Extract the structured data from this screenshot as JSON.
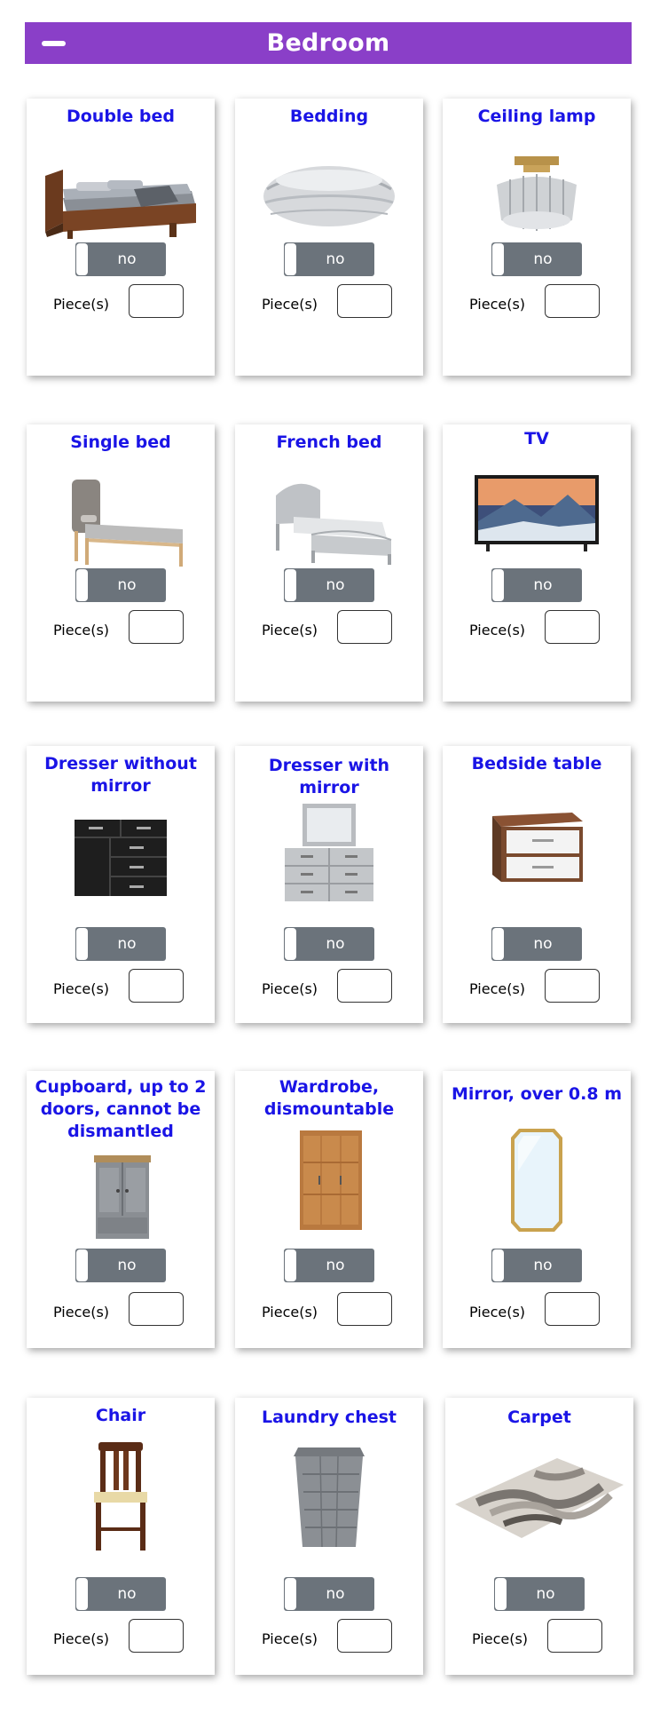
{
  "header": {
    "title": "Bedroom"
  },
  "toggle_label": "no",
  "pieces_label": "Piece(s)",
  "colors": {
    "header": "#8a3fc8",
    "title": "#1a14e6",
    "toggle": "#6b737b"
  },
  "items": [
    {
      "title": "Double bed",
      "icon": "double-bed-image",
      "quantity": ""
    },
    {
      "title": "Bedding",
      "icon": "bedding-image",
      "quantity": ""
    },
    {
      "title": "Ceiling lamp",
      "icon": "ceiling-lamp-image",
      "quantity": ""
    },
    {
      "title": "Single bed",
      "icon": "single-bed-image",
      "quantity": ""
    },
    {
      "title": "French bed",
      "icon": "french-bed-image",
      "quantity": ""
    },
    {
      "title": "TV",
      "icon": "tv-image",
      "quantity": ""
    },
    {
      "title": "Dresser without mirror",
      "icon": "dresser-image",
      "quantity": ""
    },
    {
      "title": "Dresser with mirror",
      "icon": "dresser-mirror-image",
      "quantity": ""
    },
    {
      "title": "Bedside table",
      "icon": "bedside-table-image",
      "quantity": ""
    },
    {
      "title": "Cupboard, up to 2 doors, cannot be dismantled",
      "icon": "cupboard-image",
      "quantity": ""
    },
    {
      "title": "Wardrobe, dismountable",
      "icon": "wardrobe-image",
      "quantity": ""
    },
    {
      "title": "Mirror, over 0.8 m",
      "icon": "mirror-image",
      "quantity": ""
    },
    {
      "title": "Chair",
      "icon": "chair-image",
      "quantity": ""
    },
    {
      "title": "Laundry chest",
      "icon": "laundry-chest-image",
      "quantity": ""
    },
    {
      "title": "Carpet",
      "icon": "carpet-image",
      "quantity": ""
    }
  ]
}
